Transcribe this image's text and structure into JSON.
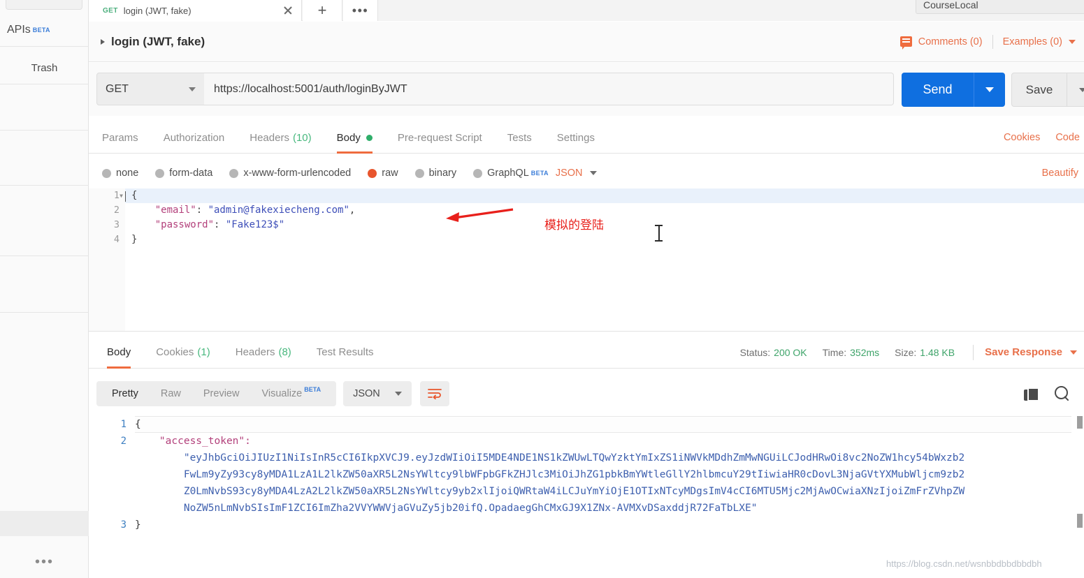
{
  "sidebar": {
    "items": [
      {
        "label": "APIs",
        "badge": "BETA"
      },
      {
        "label": "Trash"
      }
    ],
    "more_label": "•••"
  },
  "tabstrip": {
    "active_tab": {
      "method": "GET",
      "title": "login (JWT, fake)"
    },
    "new_tab_label": "+",
    "more_label": "•••"
  },
  "environment": {
    "selected": "CourseLocal",
    "caret": "▾"
  },
  "request_header": {
    "name": "login (JWT, fake)",
    "comments_label": "Comments (0)",
    "examples_label": "Examples (0)"
  },
  "url_bar": {
    "method": "GET",
    "url": "https://localhost:5001/auth/loginByJWT",
    "send_label": "Send",
    "save_label": "Save"
  },
  "request_tabs": {
    "items": [
      {
        "label": "Params",
        "active": false
      },
      {
        "label": "Authorization",
        "active": false
      },
      {
        "label": "Headers",
        "count": "(10)",
        "active": false
      },
      {
        "label": "Body",
        "active": true,
        "dot": true
      },
      {
        "label": "Pre-request Script",
        "active": false
      },
      {
        "label": "Tests",
        "active": false
      },
      {
        "label": "Settings",
        "active": false
      }
    ],
    "cookies_label": "Cookies",
    "code_label": "Code"
  },
  "body_type": {
    "options": [
      {
        "label": "none",
        "selected": false
      },
      {
        "label": "form-data",
        "selected": false
      },
      {
        "label": "x-www-form-urlencoded",
        "selected": false
      },
      {
        "label": "raw",
        "selected": true
      },
      {
        "label": "binary",
        "selected": false
      },
      {
        "label": "GraphQL",
        "selected": false,
        "badge": "BETA"
      }
    ],
    "format": "JSON",
    "beautify_label": "Beautify"
  },
  "request_body": {
    "line_numbers": [
      "1",
      "2",
      "3",
      "4"
    ],
    "lines": [
      "{",
      "    \"email\": \"admin@fakexiecheng.com\",",
      "    \"password\": \"Fake123$\"",
      "}"
    ],
    "email": "admin@fakexiecheng.com",
    "password": "Fake123$"
  },
  "annotation": {
    "text": "模拟的登陆",
    "color": "#e8201b"
  },
  "response_tabs": {
    "items": [
      {
        "label": "Body",
        "active": true
      },
      {
        "label": "Cookies",
        "count": "(1)",
        "active": false
      },
      {
        "label": "Headers",
        "count": "(8)",
        "active": false
      },
      {
        "label": "Test Results",
        "active": false
      }
    ],
    "status_key": "Status:",
    "status_value": "200 OK",
    "time_key": "Time:",
    "time_value": "352ms",
    "size_key": "Size:",
    "size_value": "1.48 KB",
    "save_response_label": "Save Response"
  },
  "response_toolbar": {
    "views": [
      {
        "label": "Pretty",
        "active": true
      },
      {
        "label": "Raw",
        "active": false
      },
      {
        "label": "Preview",
        "active": false
      },
      {
        "label": "Visualize",
        "active": false,
        "badge": "BETA"
      }
    ],
    "format": "JSON"
  },
  "response_body": {
    "line_numbers": [
      "1",
      "2",
      "3"
    ],
    "key": "\"access_token\":",
    "token_lines": [
      "\"eyJhbGciOiJIUzI1NiIsInR5cCI6IkpXVCJ9.eyJzdWIiOiI5MDE4NDE1NS1kZWUwLTQwYzktYmIxZS1iNWVkMDdhZmMwNGUiLCJodHRwOi8vc2NoZW1hcy54bWxzb2",
      "FwLm9yZy93cy8yMDA1LzA1L2lkZW50aXR5L2NsYWltcy9lbWFpbGFkZHJlc3MiOiJhZG1pbkBmYWtleGllY2hlbmcuY29tIiwiaHR0cDovL3NjaGVtYXMubWljcm9zb2",
      "Z0LmNvbS93cy8yMDA4LzA2L2lkZW50aXR5L2NsYWltcy9yb2xlIjoiQWRtaW4iLCJuYmYiOjE1OTIxNTcyMDgsImV4cCI6MTU5Mjc2MjAwOCwiaXNzIjoiZmFrZVhpZW",
      "NoZW5nLmNvbSIsImF1ZCI6ImZha2VVYWWVjaGVuZy5jb20ifQ.OpadaegGhCMxGJ9X1ZNx-AVMXvDSaxddjR72FaTbLXE\""
    ],
    "open_brace": "{",
    "close_brace": "}"
  },
  "watermark": {
    "text": "https://blog.csdn.net/wsnbbdbbdbbdbh"
  }
}
